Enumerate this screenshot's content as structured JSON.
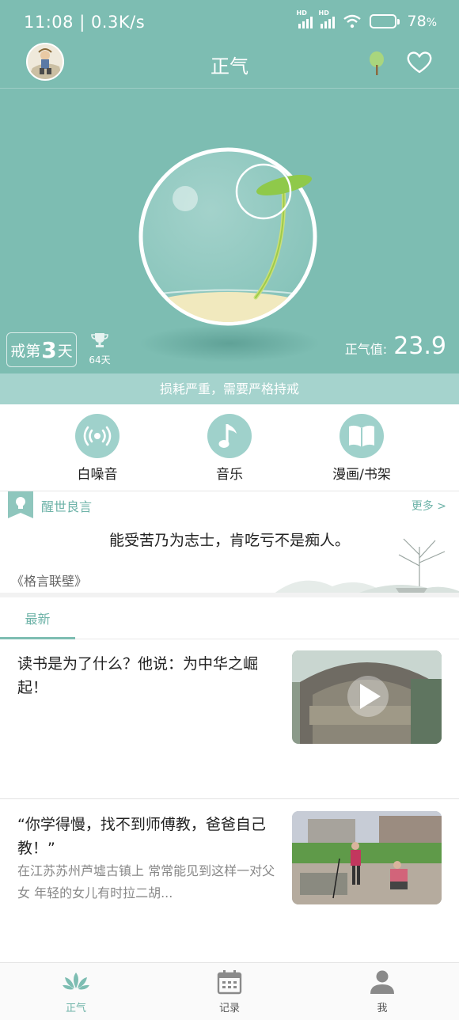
{
  "status_bar": {
    "time": "11:08 | 0.3K/s",
    "battery_percent": "78",
    "battery_level": 0.78,
    "hd_label": "HD"
  },
  "app_bar": {
    "title": "正气"
  },
  "streak": {
    "prefix": "戒第",
    "days": "3",
    "suffix": "天"
  },
  "record": {
    "days": "64天"
  },
  "score": {
    "label": "正气值:",
    "value": "23.9"
  },
  "warning": "损耗严重，需要严格持戒",
  "features": [
    {
      "label": "白噪音",
      "icon": "radio-wave-icon"
    },
    {
      "label": "音乐",
      "icon": "music-note-icon"
    },
    {
      "label": "漫画/书架",
      "icon": "book-icon"
    }
  ],
  "quote": {
    "title": "醒世良言",
    "more": "更多 >",
    "text": "能受苦乃为志士，肯吃亏不是痴人。",
    "source": "《格言联壁》"
  },
  "tabs": [
    {
      "label": "最新"
    }
  ],
  "articles": [
    {
      "title": "读书是为了什么？他说：为中华之崛起！",
      "summary": ""
    },
    {
      "title": "“你学得慢，找不到师傅教，爸爸自己教！”",
      "summary": "在江苏苏州芦墟古镇上 常常能见到这样一对父女 年轻的女儿有时拉二胡..."
    }
  ],
  "bottom_nav": [
    {
      "label": "正气",
      "icon": "lotus-icon",
      "active": true
    },
    {
      "label": "记录",
      "icon": "calendar-icon",
      "active": false
    },
    {
      "label": "我",
      "icon": "user-icon",
      "active": false
    }
  ],
  "colors": {
    "primary": "#7dbdb2",
    "accent_text": "#6eb3a8",
    "warning_bg": "#a5d3cd"
  }
}
